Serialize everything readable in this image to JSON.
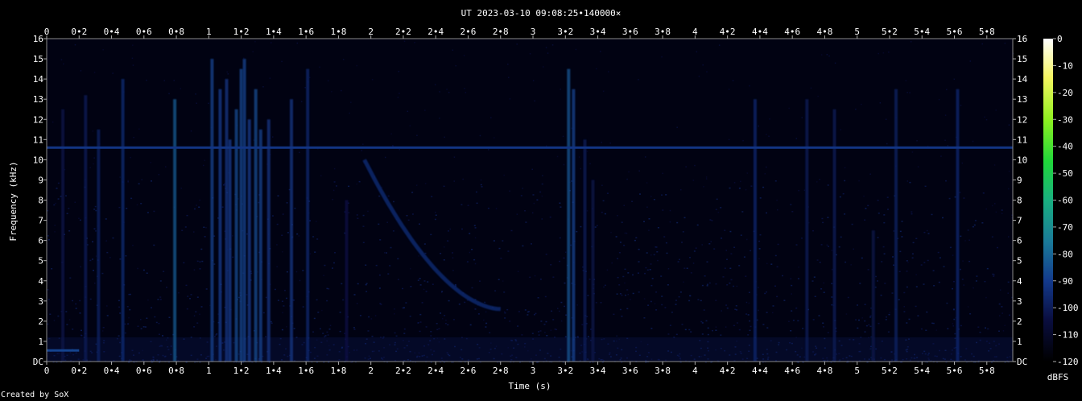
{
  "chart_data": {
    "type": "heatmap",
    "title": "UT 2023-03-10 09:08:25•140000×",
    "xlabel": "Time (s)",
    "ylabel": "Frequency (kHz)",
    "xlim": [
      0,
      5.96
    ],
    "ylim": [
      0,
      16
    ],
    "x_ticks": [
      "0",
      "0•2",
      "0•4",
      "0•6",
      "0•8",
      "1",
      "1•2",
      "1•4",
      "1•6",
      "1•8",
      "2",
      "2•2",
      "2•4",
      "2•6",
      "2•8",
      "3",
      "3•2",
      "3•4",
      "3•6",
      "3•8",
      "4",
      "4•2",
      "4•4",
      "4•6",
      "4•8",
      "5",
      "5•2",
      "5•4",
      "5•6",
      "5•8"
    ],
    "x_tick_values": [
      0,
      0.2,
      0.4,
      0.6,
      0.8,
      1,
      1.2,
      1.4,
      1.6,
      1.8,
      2,
      2.2,
      2.4,
      2.6,
      2.8,
      3,
      3.2,
      3.4,
      3.6,
      3.8,
      4,
      4.2,
      4.4,
      4.6,
      4.8,
      5,
      5.2,
      5.4,
      5.6,
      5.8
    ],
    "y_ticks": [
      "DC",
      "1",
      "2",
      "3",
      "4",
      "5",
      "6",
      "7",
      "8",
      "9",
      "10",
      "11",
      "12",
      "13",
      "14",
      "15",
      "16"
    ],
    "y_tick_values": [
      0,
      1,
      2,
      3,
      4,
      5,
      6,
      7,
      8,
      9,
      10,
      11,
      12,
      13,
      14,
      15,
      16
    ],
    "colorbar": {
      "label": "dBFS",
      "ticks": [
        "0",
        "-10",
        "-20",
        "-30",
        "-40",
        "-50",
        "-60",
        "-70",
        "-80",
        "-90",
        "-100",
        "-110",
        "-120"
      ],
      "tick_values": [
        0,
        -10,
        -20,
        -30,
        -40,
        -50,
        -60,
        -70,
        -80,
        -90,
        -100,
        -110,
        -120
      ],
      "range": [
        -120,
        0
      ]
    },
    "background_level_dbfs": -112,
    "features": {
      "constant_tone": {
        "freq_khz": 10.6,
        "level_dbfs": -92
      },
      "low_hum_tone": {
        "freq_khz": 0.55,
        "x_end_s": 0.2,
        "level_dbfs": -88
      },
      "sweep": {
        "type": "falling whistler",
        "x_start_s": 1.96,
        "x_end_s": 2.8,
        "f_start_khz": 10.0,
        "f_end_khz": 2.6,
        "level_dbfs": -95
      },
      "impulses": [
        {
          "t": 0.1,
          "f_top": 12.5,
          "level_dbfs": -103
        },
        {
          "t": 0.24,
          "f_top": 13.2,
          "level_dbfs": -100
        },
        {
          "t": 0.32,
          "f_top": 11.5,
          "level_dbfs": -98
        },
        {
          "t": 0.47,
          "f_top": 14.0,
          "level_dbfs": -95
        },
        {
          "t": 0.79,
          "f_top": 13.0,
          "level_dbfs": -82
        },
        {
          "t": 1.02,
          "f_top": 15.0,
          "level_dbfs": -88
        },
        {
          "t": 1.07,
          "f_top": 13.5,
          "level_dbfs": -90
        },
        {
          "t": 1.11,
          "f_top": 14.0,
          "level_dbfs": -92
        },
        {
          "t": 1.13,
          "f_top": 11.0,
          "level_dbfs": -90
        },
        {
          "t": 1.17,
          "f_top": 12.5,
          "level_dbfs": -86
        },
        {
          "t": 1.2,
          "f_top": 14.5,
          "level_dbfs": -87
        },
        {
          "t": 1.22,
          "f_top": 15.0,
          "level_dbfs": -88
        },
        {
          "t": 1.25,
          "f_top": 12.0,
          "level_dbfs": -90
        },
        {
          "t": 1.29,
          "f_top": 13.5,
          "level_dbfs": -86
        },
        {
          "t": 1.32,
          "f_top": 11.5,
          "level_dbfs": -88
        },
        {
          "t": 1.37,
          "f_top": 12.0,
          "level_dbfs": -92
        },
        {
          "t": 1.51,
          "f_top": 13.0,
          "level_dbfs": -92
        },
        {
          "t": 1.61,
          "f_top": 14.5,
          "level_dbfs": -96
        },
        {
          "t": 1.85,
          "f_top": 8.0,
          "level_dbfs": -104
        },
        {
          "t": 3.22,
          "f_top": 14.5,
          "level_dbfs": -84
        },
        {
          "t": 3.25,
          "f_top": 13.5,
          "level_dbfs": -88
        },
        {
          "t": 3.32,
          "f_top": 11.0,
          "level_dbfs": -100
        },
        {
          "t": 3.37,
          "f_top": 9.0,
          "level_dbfs": -103
        },
        {
          "t": 4.37,
          "f_top": 13.0,
          "level_dbfs": -96
        },
        {
          "t": 4.69,
          "f_top": 13.0,
          "level_dbfs": -100
        },
        {
          "t": 4.86,
          "f_top": 12.5,
          "level_dbfs": -100
        },
        {
          "t": 5.1,
          "f_top": 6.5,
          "level_dbfs": -103
        },
        {
          "t": 5.24,
          "f_top": 13.5,
          "level_dbfs": -98
        },
        {
          "t": 5.62,
          "f_top": 13.5,
          "level_dbfs": -96
        }
      ]
    }
  },
  "footer": {
    "credit": "Created by SoX"
  }
}
